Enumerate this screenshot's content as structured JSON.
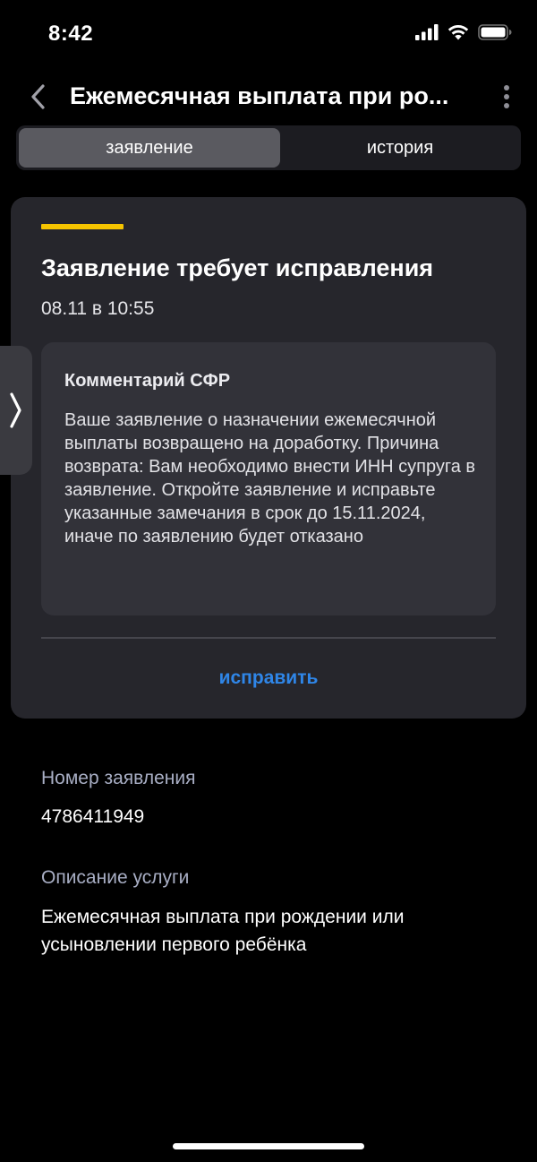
{
  "status_bar": {
    "time": "8:42"
  },
  "header": {
    "title": "Ежемесячная выплата при ро...",
    "back_icon": "chevron-left-icon",
    "more_icon": "more-vertical-icon"
  },
  "tabs": [
    {
      "label": "заявление",
      "active": true
    },
    {
      "label": "история",
      "active": false
    }
  ],
  "card": {
    "accent_color": "#f5c400",
    "title": "Заявление требует исправления",
    "date": "08.11 в 10:55",
    "comment": {
      "title": "Комментарий СФР",
      "text": "Ваше заявление о назначении ежемесячной выплаты возвращено на доработку. Причина возврата: Вам необходимо внести ИНН супруга в заявление. Откройте заявление и исправьте указанные замечания в срок до 15.11.2024, иначе по заявлению будет отказано"
    },
    "action_label": "исправить",
    "action_color": "#2f86e8"
  },
  "details": {
    "number_label": "Номер заявления",
    "number_value": "4786411949",
    "service_label": "Описание услуги",
    "service_value": "Ежемесячная выплата при рождении или усыновлении первого ребёнка"
  }
}
